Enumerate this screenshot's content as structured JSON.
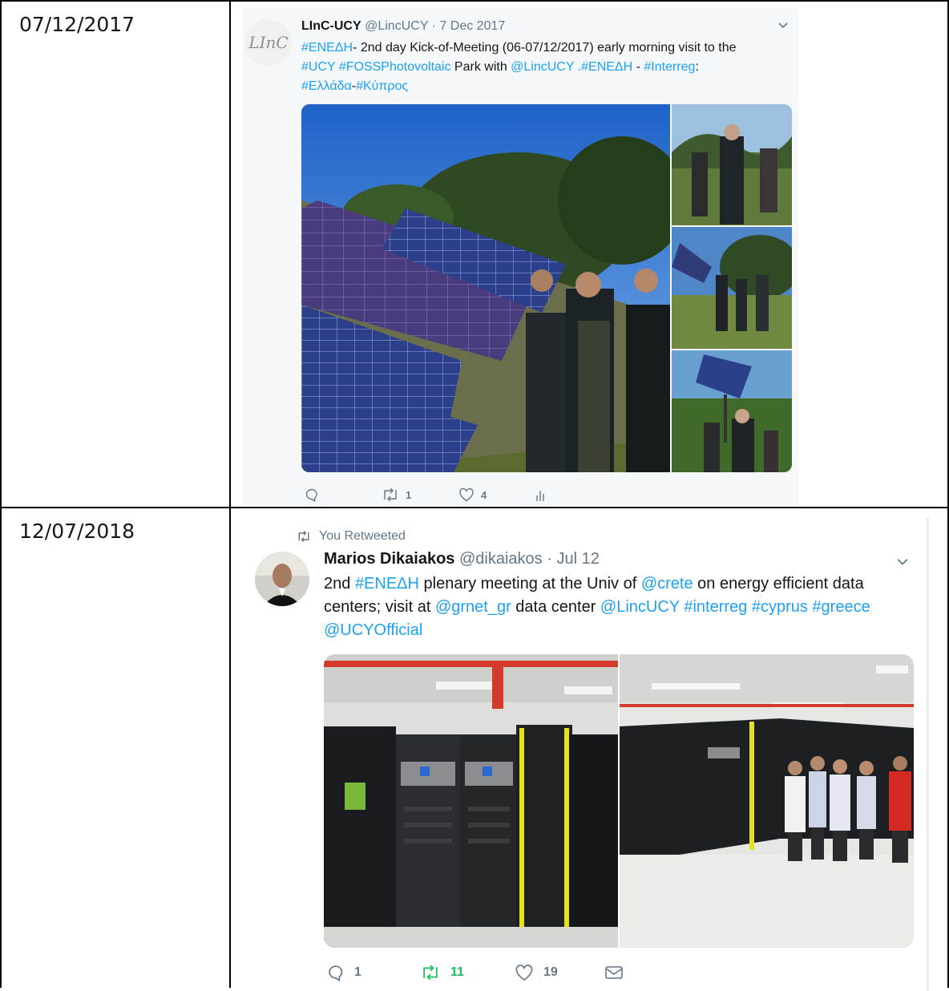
{
  "rows": [
    {
      "date": "07/12/2017",
      "tweet": {
        "avatar_text": "LInC",
        "author": "LInC-UCY",
        "handle": "@LincUCY",
        "dot": "·",
        "time": "7 Dec 2017",
        "text_parts": {
          "p1_link": "#ΕΝΕΔΗ",
          "p2": "- 2nd day Kick-of-Meeting (06-07/12/2017) early morning visit to the",
          "p3_link": "#UCY #FOSSPhotovoltaic",
          "p4": " Park with ",
          "p5_link": "@LincUCY .#ΕΝΕΔΗ",
          "p6": " - ",
          "p7_link": "#Interreg",
          "p8": ":",
          "p9_link": "#Ελλάδα",
          "p10": "-",
          "p11_link": "#Κύπρος"
        },
        "reply_count": "",
        "retweet_count": "1",
        "like_count": "4",
        "icons": [
          "reply-icon",
          "retweet-icon",
          "like-icon",
          "analytics-icon",
          "chevron-down-icon"
        ]
      }
    },
    {
      "date": "12/07/2018",
      "tweet": {
        "retweeted_label": "You Retweeted",
        "author": "Marios Dikaiakos",
        "handle": "@dikaiakos",
        "dot": "·",
        "time": "Jul 12",
        "text_parts": {
          "p1": "2nd ",
          "p2_link": "#ΕΝΕΔΗ",
          "p3": " plenary meeting at the Univ of ",
          "p4_link": "@crete",
          "p5": " on energy efficient data",
          "p6": "centers; visit at ",
          "p7_link": "@grnet_gr",
          "p8": " data center ",
          "p9_link": "@LincUCY #interreg #cyprus #greece",
          "p10_link": "@UCYOfficial"
        },
        "reply_count": "1",
        "retweet_count": "11",
        "like_count": "19",
        "icons": [
          "retweet-small-icon",
          "reply-icon",
          "retweet-icon",
          "like-icon",
          "mail-icon",
          "chevron-down-icon"
        ]
      }
    }
  ],
  "colors": {
    "link": "#1da1f2",
    "muted": "#657786",
    "retweeted_green": "#17bf63",
    "panel_bg": "#f5f8fa"
  }
}
